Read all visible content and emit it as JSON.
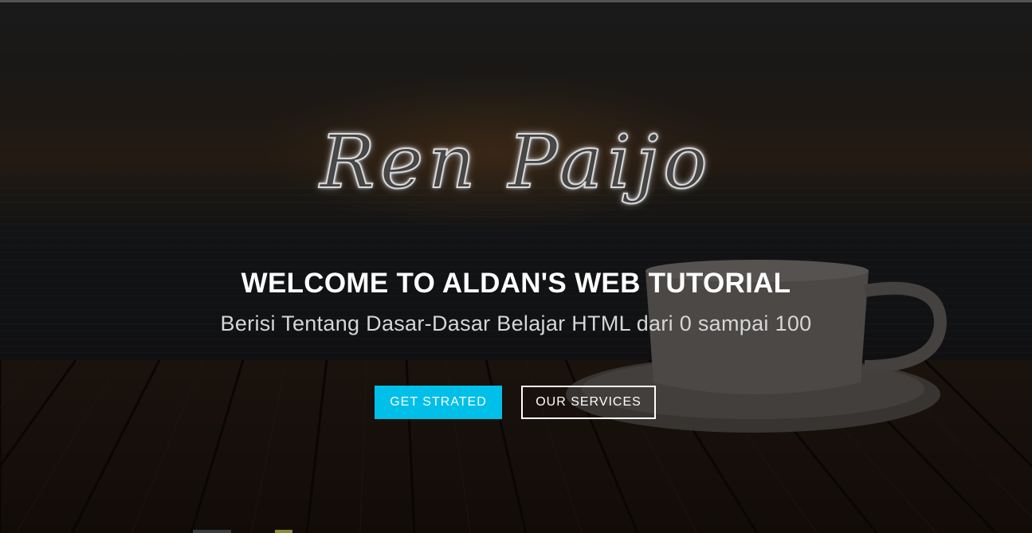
{
  "hero": {
    "logo_text": "Ren Paijo",
    "title": "WELCOME TO ALDAN'S WEB TUTORIAL",
    "subtitle": "Berisi Tentang Dasar-Dasar Belajar HTML dari 0 sampai 100"
  },
  "buttons": {
    "primary_label": "GET STRATED",
    "secondary_label": "OUR SERVICES"
  },
  "colors": {
    "accent": "#00bfe8",
    "title_text": "#ffffff",
    "subtitle_text": "#d6d6d6"
  }
}
